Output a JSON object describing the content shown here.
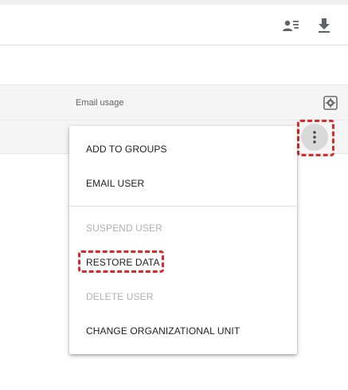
{
  "toolbar": {
    "buttons": [
      {
        "icon": "manage-users-icon"
      },
      {
        "icon": "download-icon"
      }
    ]
  },
  "table": {
    "columns": [
      {
        "label": "Email usage"
      }
    ],
    "settings_icon": "column-settings-icon"
  },
  "row": {
    "more_icon": "more-vert-icon"
  },
  "menu": {
    "items": [
      {
        "label": "ADD TO GROUPS",
        "enabled": true
      },
      {
        "label": "EMAIL USER",
        "enabled": true
      },
      {
        "label": "SUSPEND USER",
        "enabled": false
      },
      {
        "label": "RESTORE DATA",
        "enabled": true,
        "highlighted": true
      },
      {
        "label": "DELETE USER",
        "enabled": false
      },
      {
        "label": "CHANGE ORGANIZATIONAL UNIT",
        "enabled": true
      }
    ]
  },
  "colors": {
    "highlight": "#d92b2b",
    "disabled_text": "#b0b0b0",
    "header_background": "#f5f5f5"
  }
}
